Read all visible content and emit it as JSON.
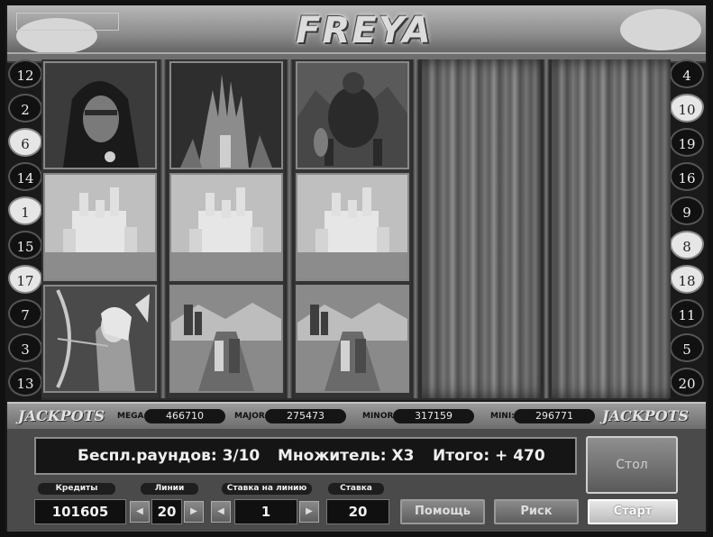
{
  "game": {
    "title": "FREYA"
  },
  "lines_left": [
    "12",
    "2",
    "6",
    "14",
    "1",
    "15",
    "17",
    "7",
    "3",
    "13"
  ],
  "lines_left_heart": [
    false,
    false,
    true,
    false,
    true,
    false,
    true,
    false,
    false,
    false
  ],
  "lines_right": [
    "4",
    "10",
    "19",
    "16",
    "9",
    "8",
    "18",
    "11",
    "5",
    "20"
  ],
  "lines_right_heart": [
    false,
    true,
    false,
    false,
    false,
    true,
    true,
    false,
    false,
    false
  ],
  "reels": [
    [
      "hooded-warrior",
      "dark-castle",
      "archer-elf"
    ],
    [
      "dark-castle-tower",
      "white-castle",
      "heroes-on-bridge"
    ],
    [
      "armored-giant",
      "white-castle",
      "heroes-on-bridge"
    ],
    [
      "spinning"
    ],
    [
      "spinning"
    ]
  ],
  "jackpots": {
    "title_left": "JACKPOTS",
    "title_right": "JACKPOTS",
    "mega_label": "MEGA:",
    "mega_value": "466710",
    "major_label": "MAJOR:",
    "major_value": "275473",
    "minor_label": "MINOR:",
    "minor_value": "317159",
    "mini_label": "MINI:",
    "mini_value": "296771"
  },
  "message": {
    "free_rounds": "Беспл.раундов: 3/10",
    "multiplier": "Множитель: X3",
    "total": "Итого: + 470"
  },
  "controls": {
    "credits_label": "Кредиты",
    "credits_value": "101605",
    "lines_label": "Линии",
    "lines_value": "20",
    "bet_per_line_label": "Ставка на линию",
    "bet_per_line_value": "1",
    "bet_label": "Ставка",
    "bet_value": "20",
    "help_label": "Помощь",
    "risk_label": "Риск",
    "start_label": "Старт",
    "table_label": "Стол"
  }
}
